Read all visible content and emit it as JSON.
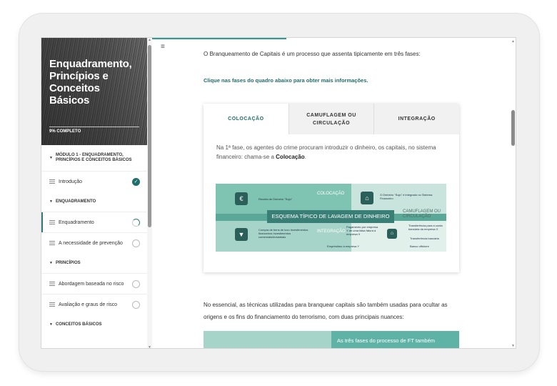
{
  "course": {
    "title": "Enquadramento, Princípios e Conceitos Básicos",
    "progress_text": "9% COMPLETO"
  },
  "sidebar": {
    "sections": [
      {
        "label": "MÓDULO 1 - ENQUADRAMENTO, PRINCÍPIOS E CONCEITOS BÁSICOS"
      },
      {
        "label": "ENQUADRAMENTO"
      },
      {
        "label": "PRINCÍPIOS"
      },
      {
        "label": "CONCEITOS BÁSICOS"
      }
    ],
    "items": [
      {
        "label": "Introdução",
        "status": "complete"
      },
      {
        "label": "Enquadramento",
        "status": "in-progress"
      },
      {
        "label": "A necessidade de prevenção",
        "status": "not-started"
      },
      {
        "label": "Abordagem baseada no risco",
        "status": "not-started"
      },
      {
        "label": "Avaliação e graus de risco",
        "status": "not-started"
      }
    ]
  },
  "main": {
    "intro": "O Branqueamento de Capitais é um processo que assenta tipicamente em três fases:",
    "click_hint": "Clique nas fases do quadro abaixo para obter mais informações.",
    "tabs": [
      {
        "label": "COLOCAÇÃO",
        "active": true
      },
      {
        "label": "CAMUFLAGEM OU CIRCULAÇÃO",
        "active": false
      },
      {
        "label": "INTEGRAÇÃO",
        "active": false
      }
    ],
    "tab_text_before": "Na 1ª fase, os agentes do crime procuram introduzir o dinheiro, os capitais, no sistema financeiro: chama-se a ",
    "tab_text_bold": "Colocação",
    "tab_text_after": ".",
    "diagram": {
      "banner": "ESQUEMA TÍPICO DE LAVAGEM DE DINHEIRO",
      "phase_1": "COLOCAÇÃO",
      "phase_2": "CAMUFLAGEM OU CIRCULAÇÃO",
      "phase_3": "INTEGRAÇÃO",
      "label_receita": "Receita de Dinheiro \"Sujo\"",
      "label_sistema": "O Dinheiro \"Sujo\" é integrado no Sistema Financeiro",
      "label_compra": "Compra de bens de luxo Investimentos financeiros Investimentos comerciais/industriais",
      "label_pagamento": "Pagamento por empresa Y de uma falsa fatura à empresa X",
      "label_transferencia": "Transferência para a conta bancária da empresa X",
      "label_emprestimo": "Empréstimo à empresa Y",
      "label_transferencia2": "Transferência bancária",
      "label_banco": "Banco offshore"
    },
    "para2": "No essencial, as técnicas utilizadas para branquear capitais são também usadas para ocultar as origens e os fins do financiamento do terrorismo, com duas principais nuances:",
    "bottom_card_right": "As três fases do processo de FT também"
  },
  "colors": {
    "accent": "#1f6f6b",
    "teal": "#5fb3a6",
    "teal_light": "#a6d4c8"
  }
}
